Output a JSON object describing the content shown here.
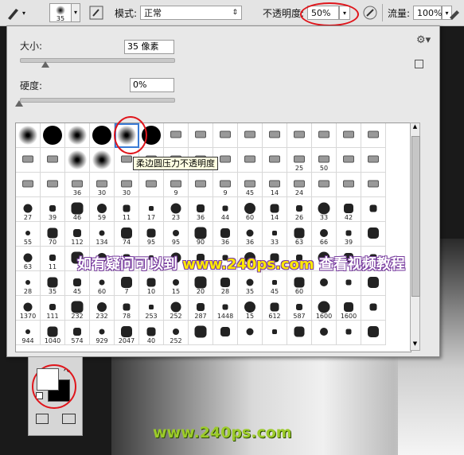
{
  "toolbar": {
    "brush_size": "35",
    "mode_label": "模式:",
    "mode_value": "正常",
    "opacity_label": "不透明度:",
    "opacity_value": "50%",
    "flow_label": "流量:",
    "flow_value": "100%"
  },
  "panel": {
    "size_label": "大小:",
    "size_value": "35 像素",
    "hardness_label": "硬度:",
    "hardness_value": "0%",
    "tooltip": "柔边圆压力不透明度"
  },
  "brush_numbers": [
    "",
    "",
    "",
    "",
    "",
    "",
    "",
    "",
    "",
    "",
    "",
    "",
    "",
    "",
    "",
    "",
    "",
    "",
    "",
    "",
    "",
    "",
    "",
    "",
    "",
    "",
    "25",
    "50",
    "",
    "",
    "",
    "",
    "36",
    "30",
    "30",
    "",
    "9",
    "",
    "9",
    "45",
    "14",
    "24",
    "",
    "",
    "",
    "27",
    "39",
    "46",
    "59",
    "11",
    "17",
    "23",
    "36",
    "44",
    "60",
    "14",
    "26",
    "33",
    "42",
    "",
    "55",
    "70",
    "112",
    "134",
    "74",
    "95",
    "95",
    "90",
    "36",
    "36",
    "33",
    "63",
    "66",
    "39",
    "",
    "63",
    "11",
    "",
    "",
    "",
    "",
    "",
    "",
    "",
    "",
    "",
    "",
    "",
    "",
    "",
    "28",
    "35",
    "45",
    "60",
    "7",
    "10",
    "15",
    "20",
    "28",
    "35",
    "45",
    "60",
    "",
    "",
    "",
    "1370",
    "111",
    "232",
    "232",
    "78",
    "253",
    "252",
    "287",
    "1448",
    "15",
    "612",
    "587",
    "1600",
    "1600",
    "",
    "944",
    "1040",
    "574",
    "929",
    "2047",
    "40",
    "252",
    "",
    "",
    "",
    "",
    "",
    "",
    "",
    ""
  ],
  "watermark": {
    "mid_prefix": "如有疑问可以到",
    "mid_url": "www.240ps.com",
    "mid_suffix": "查看视频教程",
    "bottom": "www.240ps.com"
  },
  "colors": {
    "accent_red": "#e0151b",
    "watermark_green": "#9ccb2a"
  },
  "icons": {
    "brush": "brush-icon",
    "airbrush": "airbrush-icon",
    "gear": "gear-icon",
    "swap": "swap-colors-icon"
  }
}
